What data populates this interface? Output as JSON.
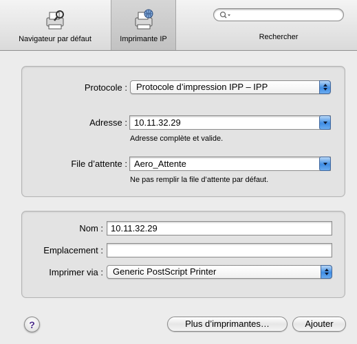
{
  "toolbar": {
    "default_browser_label": "Navigateur par défaut",
    "ip_printer_label": "Imprimante IP",
    "search_placeholder": "",
    "search_label": "Rechercher"
  },
  "connection": {
    "protocol_label": "Protocole :",
    "protocol_value": "Protocole d’impression IPP – IPP",
    "address_label": "Adresse :",
    "address_value": "10.11.32.29",
    "address_hint": "Adresse complète et valide.",
    "queue_label": "File d’attente :",
    "queue_value": "Aero_Attente",
    "queue_hint": "Ne pas remplir la file d’attente par défaut."
  },
  "printer": {
    "name_label": "Nom :",
    "name_value": "10.11.32.29",
    "location_label": "Emplacement :",
    "location_value": "",
    "print_using_label": "Imprimer via :",
    "print_using_value": "Generic PostScript Printer"
  },
  "buttons": {
    "help": "?",
    "more_printers": "Plus d’imprimantes…",
    "add": "Ajouter"
  },
  "icons": {
    "default_browser": "printer-magnifier-icon",
    "ip_printer": "printer-globe-icon",
    "search": "search-icon"
  },
  "colors": {
    "accent_blue": "#3f8de4"
  }
}
